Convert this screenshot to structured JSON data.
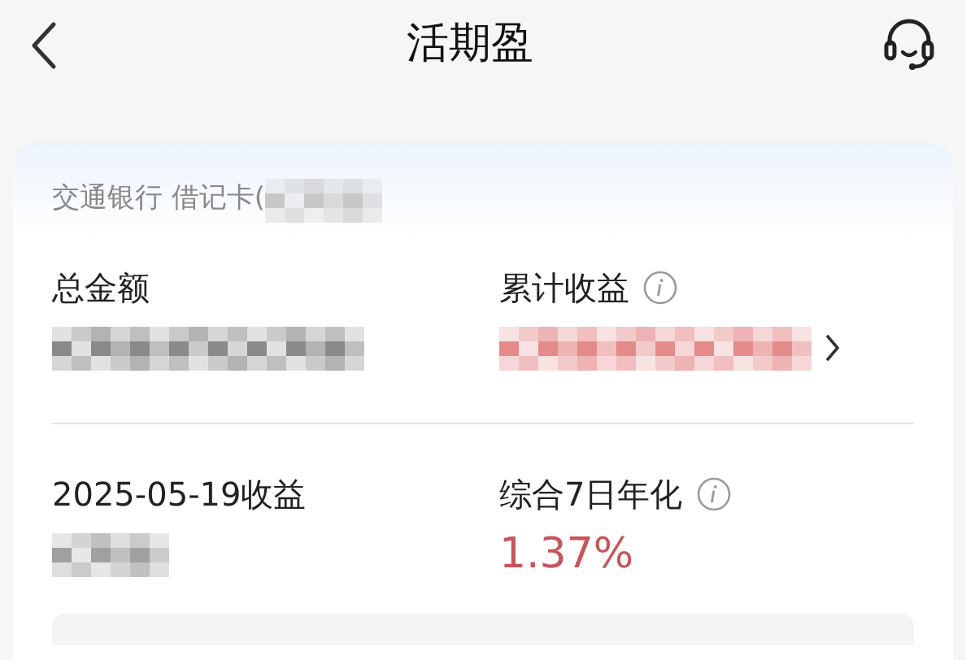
{
  "header": {
    "title": "活期盈"
  },
  "card": {
    "account": {
      "label": "交通银行 借记卡(",
      "masked": true
    },
    "rows": [
      {
        "cells": [
          {
            "label": "总金额",
            "info": false,
            "value": {
              "kind": "masked",
              "color": "#8a8a8a"
            },
            "chevron": false
          },
          {
            "label": "累计收益",
            "info": true,
            "value": {
              "kind": "masked",
              "color": "#e58a8a"
            },
            "chevron": true
          }
        ]
      },
      {
        "cells": [
          {
            "label": "2025-05-19收益",
            "info": false,
            "value": {
              "kind": "masked",
              "color": "#a0a0a0"
            },
            "chevron": false
          },
          {
            "label": "综合7日年化",
            "info": true,
            "value": {
              "kind": "text",
              "text": "1.37%"
            },
            "chevron": false
          }
        ]
      }
    ]
  }
}
